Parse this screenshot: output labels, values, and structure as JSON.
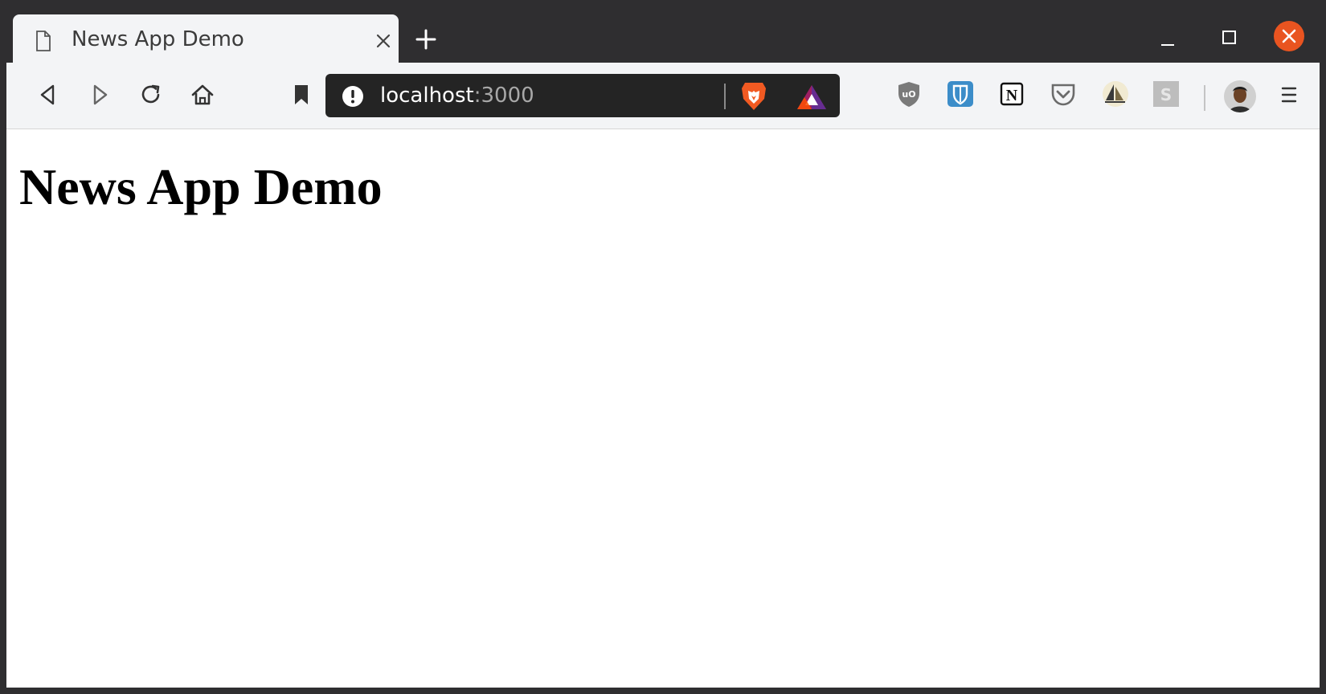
{
  "tab": {
    "title": "News App Demo"
  },
  "address_bar": {
    "host": "localhost",
    "port": ":3000"
  },
  "page": {
    "heading": "News App Demo"
  },
  "extensions": [
    {
      "name": "ublock-origin-icon",
      "color": "#7a7a7a"
    },
    {
      "name": "bitwarden-icon",
      "color": "#3c8dc9"
    },
    {
      "name": "notion-icon",
      "color": "#111111"
    },
    {
      "name": "pocket-icon",
      "color": "#6b6b6b"
    },
    {
      "name": "sailboat-extension-icon",
      "color": "#3a3a3a"
    },
    {
      "name": "s-extension-icon",
      "color": "#bdbdbd",
      "label": "S"
    }
  ],
  "colors": {
    "titlebar": "#2f2e30",
    "toolbar": "#f3f4f6",
    "urlbar": "#242424",
    "close_button": "#e95420",
    "brave_orange": "#f15a22"
  }
}
